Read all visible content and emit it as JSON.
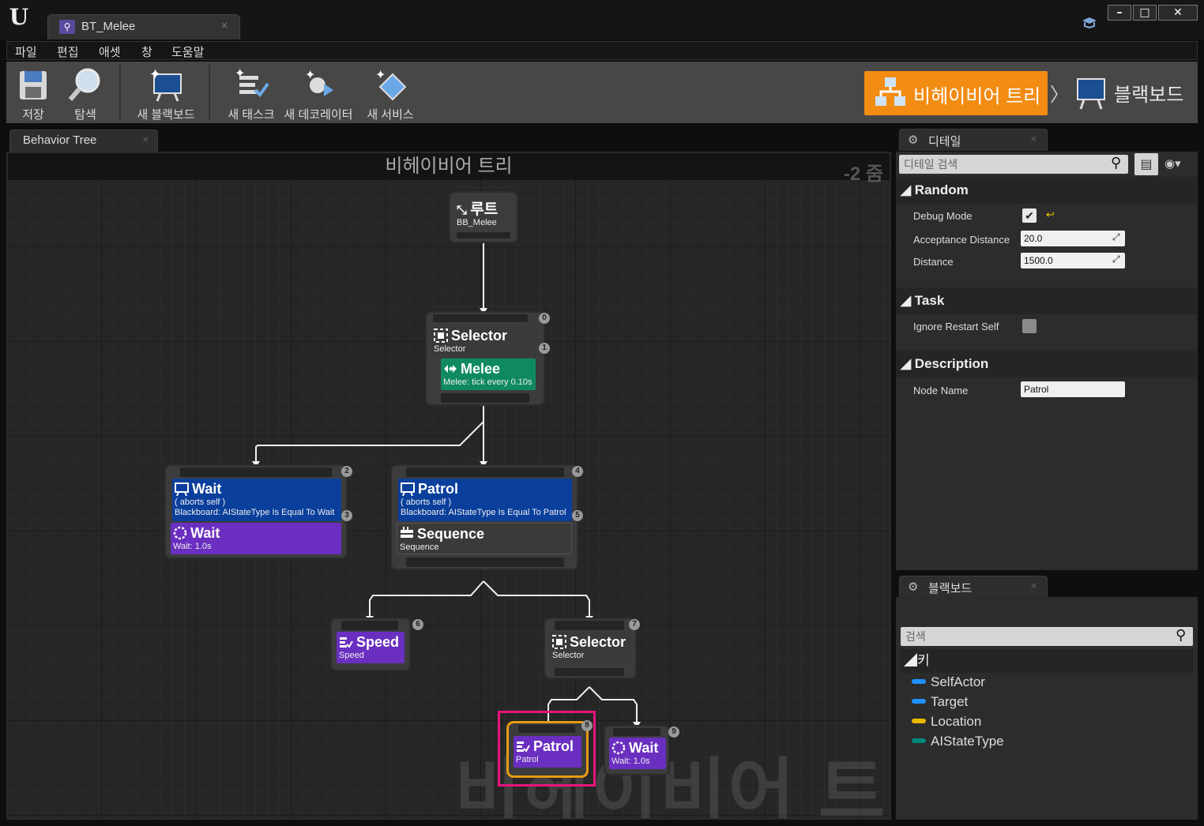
{
  "window": {
    "title": "BT_Melee"
  },
  "menu": [
    "파일",
    "편집",
    "애셋",
    "창",
    "도움말"
  ],
  "toolbar": {
    "save": "저장",
    "find": "탐색",
    "new_blackboard": "새 블랙보드",
    "new_task": "새 태스크",
    "new_decorator": "새 데코레이터",
    "new_service": "새 서비스"
  },
  "modes": {
    "behavior_tree": "비헤이비어 트리",
    "blackboard": "블랙보드",
    "separator": "〉"
  },
  "graph_tab": "Behavior Tree",
  "graph": {
    "title": "비헤이비어 트리",
    "zoom": "-2 줌",
    "watermark": "비헤이비어 트리",
    "nodes": {
      "root": {
        "title": "루트",
        "sub": "BB_Melee"
      },
      "selector0": {
        "title": "Selector",
        "sub": "Selector",
        "index": "0"
      },
      "melee": {
        "title": "Melee",
        "sub": "Melee: tick every 0.10s",
        "index": "1"
      },
      "wait_dec": {
        "title": "Wait",
        "sub1": "( aborts self )",
        "sub2": "Blackboard: AIStateType Is Equal To Wait",
        "index": "2"
      },
      "wait_task": {
        "title": "Wait",
        "sub": "Wait: 1.0s",
        "index": "3"
      },
      "patrol_dec": {
        "title": "Patrol",
        "sub1": "( aborts self )",
        "sub2": "Blackboard: AIStateType Is Equal To Patrol",
        "index": "4"
      },
      "sequence": {
        "title": "Sequence",
        "sub": "Sequence",
        "index": "5"
      },
      "speed": {
        "title": "Speed",
        "sub": "Speed",
        "index": "6"
      },
      "selector7": {
        "title": "Selector",
        "sub": "Selector",
        "index": "7"
      },
      "patrol_task": {
        "title": "Patrol",
        "sub": "Patrol",
        "index": "8"
      },
      "wait9": {
        "title": "Wait",
        "sub": "Wait: 1.0s",
        "index": "9"
      }
    }
  },
  "details": {
    "tab": "디테일",
    "search_placeholder": "디테일 검색",
    "categories": {
      "random": {
        "label": "Random",
        "debug_mode_label": "Debug Mode",
        "debug_mode_checked": true,
        "acceptance_label": "Acceptance Distance",
        "acceptance_value": "20.0",
        "distance_label": "Distance",
        "distance_value": "1500.0"
      },
      "task": {
        "label": "Task",
        "ignore_label": "Ignore Restart Self",
        "ignore_checked": false
      },
      "description": {
        "label": "Description",
        "node_name_label": "Node Name",
        "node_name_value": "Patrol"
      }
    }
  },
  "blackboard": {
    "tab": "블랙보드",
    "search_placeholder": "검색",
    "keys_label": "키",
    "keys": [
      {
        "name": "SelfActor",
        "color": "#1e90ff"
      },
      {
        "name": "Target",
        "color": "#1e90ff"
      },
      {
        "name": "Location",
        "color": "#e8b800"
      },
      {
        "name": "AIStateType",
        "color": "#00897b"
      }
    ]
  },
  "colors": {
    "accent": "#f28c13",
    "decorator": "#0a3f9c",
    "service": "#0f8a5f",
    "task": "#6a2fc0",
    "highlight": "#e8147a"
  }
}
